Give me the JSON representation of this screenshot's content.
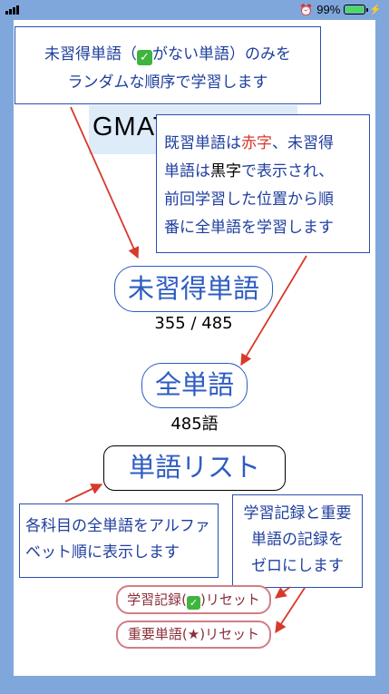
{
  "status_bar": {
    "battery_text": "99%",
    "battery_level": 0.99,
    "alarm_icon": "alarm-clock-icon",
    "charging_icon": "bolt-icon"
  },
  "header": {
    "title": "GMAT"
  },
  "callouts": {
    "random": {
      "before_check": "未習得単語（",
      "after_check": "がない単語）のみを",
      "line2": "ランダムな順序で学習します"
    },
    "all": {
      "p1": "既習単語は",
      "red_word": "赤字",
      "p2": "、未習得",
      "p3": "単語は",
      "black_word": "黒字",
      "p4": "で表示され、",
      "line3": "前回学習した位置から順",
      "line4": "番に全単語を学習します"
    },
    "wordlist": {
      "line1": "各科目の全単語をアルファ",
      "line2": "ベット順に表示します"
    },
    "reset": {
      "line1": "学習記録と重要",
      "line2": "単語の記録を",
      "line3": "ゼロにします"
    }
  },
  "buttons": {
    "unlearned": {
      "label": "未習得単語",
      "count": "355 / 485"
    },
    "all_words": {
      "label": "全単語",
      "count": "485語"
    },
    "word_list": {
      "label": "単語リスト"
    },
    "reset_learning": {
      "before": "学習記録(",
      "after": ")リセット"
    },
    "reset_important": {
      "label": "重要単語(★)リセット"
    }
  },
  "check_glyph": "✓",
  "colors": {
    "background": "#7fa7dc",
    "accent": "#2e5cc2",
    "red_text": "#d8392b",
    "reset_border": "#d27d86"
  }
}
